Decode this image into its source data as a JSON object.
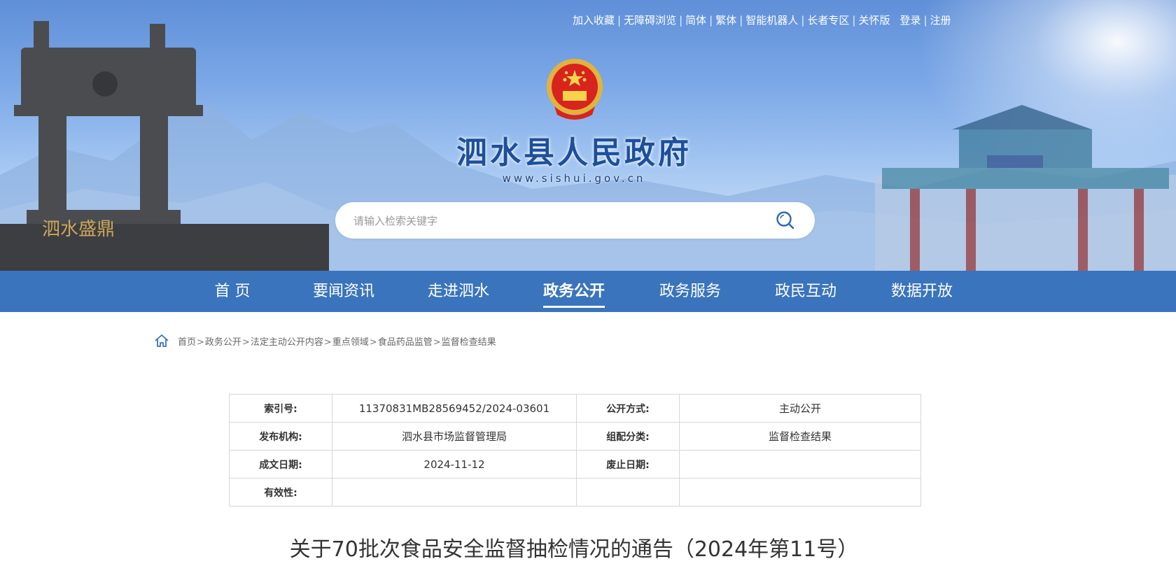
{
  "header": {
    "top_links": [
      "加入收藏",
      "无障碍浏览",
      "简体",
      "繁体",
      "智能机器人",
      "长者专区",
      "关怀版"
    ],
    "login": "登录",
    "register": "注册",
    "site_name": "泗水县人民政府",
    "site_url": "www.sishui.gov.cn"
  },
  "search": {
    "placeholder": "请输入检索关键字"
  },
  "nav": {
    "items": [
      "首 页",
      "要闻资讯",
      "走进泗水",
      "政务公开",
      "政务服务",
      "政民互动",
      "数据开放"
    ],
    "active": "政务公开"
  },
  "breadcrumb": [
    "首页",
    "政务公开",
    "法定主动公开内容",
    "重点领域",
    "食品药品监管",
    "监督检查结果"
  ],
  "meta": {
    "index_label": "索引号:",
    "index_value": "11370831MB28569452/2024-03601",
    "publish_method_label": "公开方式:",
    "publish_method_value": "主动公开",
    "publisher_label": "发布机构:",
    "publisher_value": "泗水县市场监督管理局",
    "category_label": "组配分类:",
    "category_value": "监督检查结果",
    "date_label": "成文日期:",
    "date_value": "2024-11-12",
    "expire_label": "废止日期:",
    "expire_value": "",
    "validity_label": "有效性:",
    "validity_value": ""
  },
  "article": {
    "title": "关于70批次食品安全监督抽检情况的通告（2024年第11号）"
  },
  "colors": {
    "nav_bg": "#3a74bc",
    "title_blue": "#1d4f9c"
  }
}
